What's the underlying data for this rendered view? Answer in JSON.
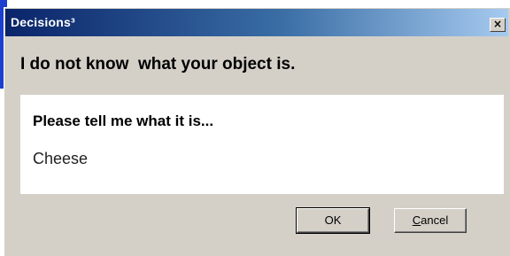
{
  "window": {
    "title": "Decisions³",
    "close_glyph": "×"
  },
  "dialog": {
    "message": "I do not know  what your object is.",
    "prompt": "Please tell me what it is...",
    "answer_value": "Cheese"
  },
  "buttons": {
    "ok_label": "OK",
    "cancel_accel": "C",
    "cancel_rest": "ancel"
  },
  "colors": {
    "titlebar_start": "#0a246a",
    "titlebar_end": "#a6caf0",
    "window_face": "#d4d0c8"
  }
}
